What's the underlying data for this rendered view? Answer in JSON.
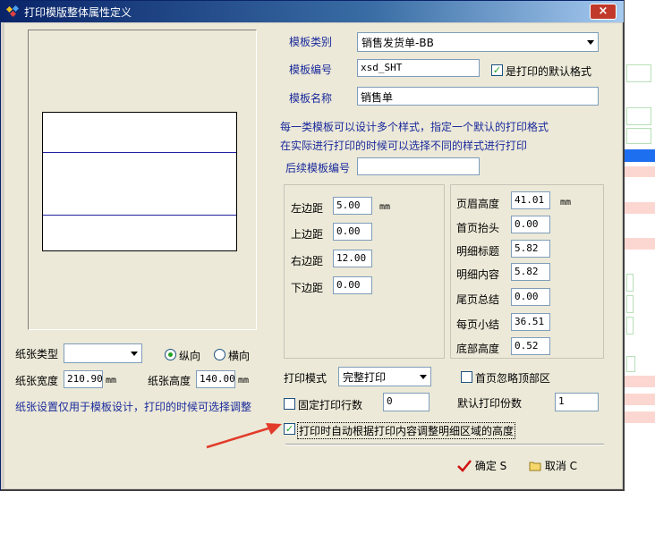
{
  "window": {
    "title": "打印模版整体属性定义",
    "close_label": "×"
  },
  "paper": {
    "type_label": "纸张类型",
    "type_value": "",
    "orientation_portrait": "纵向",
    "orientation_landscape": "横向",
    "orientation_selected": "纵向",
    "width_label": "纸张宽度",
    "width_value": "210.90",
    "width_unit": "mm",
    "height_label": "纸张高度",
    "height_value": "140.00",
    "height_unit": "mm",
    "note": "纸张设置仅用于模板设计，打印的时候可选择调整"
  },
  "template": {
    "type_label": "模板类别",
    "type_value": "销售发货单-BB",
    "code_label": "模板编号",
    "code_value": "xsd_SHT",
    "default_label": "是打印的默认格式",
    "default_checked": true,
    "name_label": "模板名称",
    "name_value": "销售单",
    "hint_line1": "每一类模板可以设计多个样式，指定一个默认的打印格式",
    "hint_line2": "在实际进行打印的时候可以选择不同的样式进行打印",
    "next_label": "后续模板编号",
    "next_value": ""
  },
  "margins": {
    "left_label": "左边距",
    "left_value": "5.00",
    "unit": "mm",
    "top_label": "上边距",
    "top_value": "0.00",
    "right_label": "右边距",
    "right_value": "12.00",
    "bottom_label": "下边距",
    "bottom_value": "0.00"
  },
  "sections": {
    "header_label": "页眉高度",
    "header_value": "41.01",
    "unit": "mm",
    "firstpage_label": "首页抬头",
    "firstpage_value": "0.00",
    "detailtitle_label": "明细标题",
    "detailtitle_value": "5.82",
    "detailcontent_label": "明细内容",
    "detailcontent_value": "5.82",
    "footertotal_label": "尾页总结",
    "footertotal_value": "0.00",
    "pagesubtotal_label": "每页小结",
    "pagesubtotal_value": "36.51",
    "bottom_label": "底部高度",
    "bottom_value": "0.52"
  },
  "print": {
    "mode_label": "打印模式",
    "mode_value": "完整打印",
    "ignore_header_label": "首页忽略顶部区",
    "fixed_rows_label": "固定打印行数",
    "fixed_rows_value": "0",
    "copies_label": "默认打印份数",
    "copies_value": "1",
    "auto_adjust_label": "打印时自动根据打印内容调整明细区域的高度",
    "auto_adjust_checked": true
  },
  "buttons": {
    "ok": "确定 S",
    "cancel": "取消 C"
  },
  "icons": {
    "ok": "checkmark-icon",
    "cancel": "folder-icon",
    "arrow": "red-arrow-icon"
  },
  "colors": {
    "titlebar": "#0a246a",
    "label_blue": "#1a2a9c",
    "arrow_red": "#e23b2a"
  }
}
